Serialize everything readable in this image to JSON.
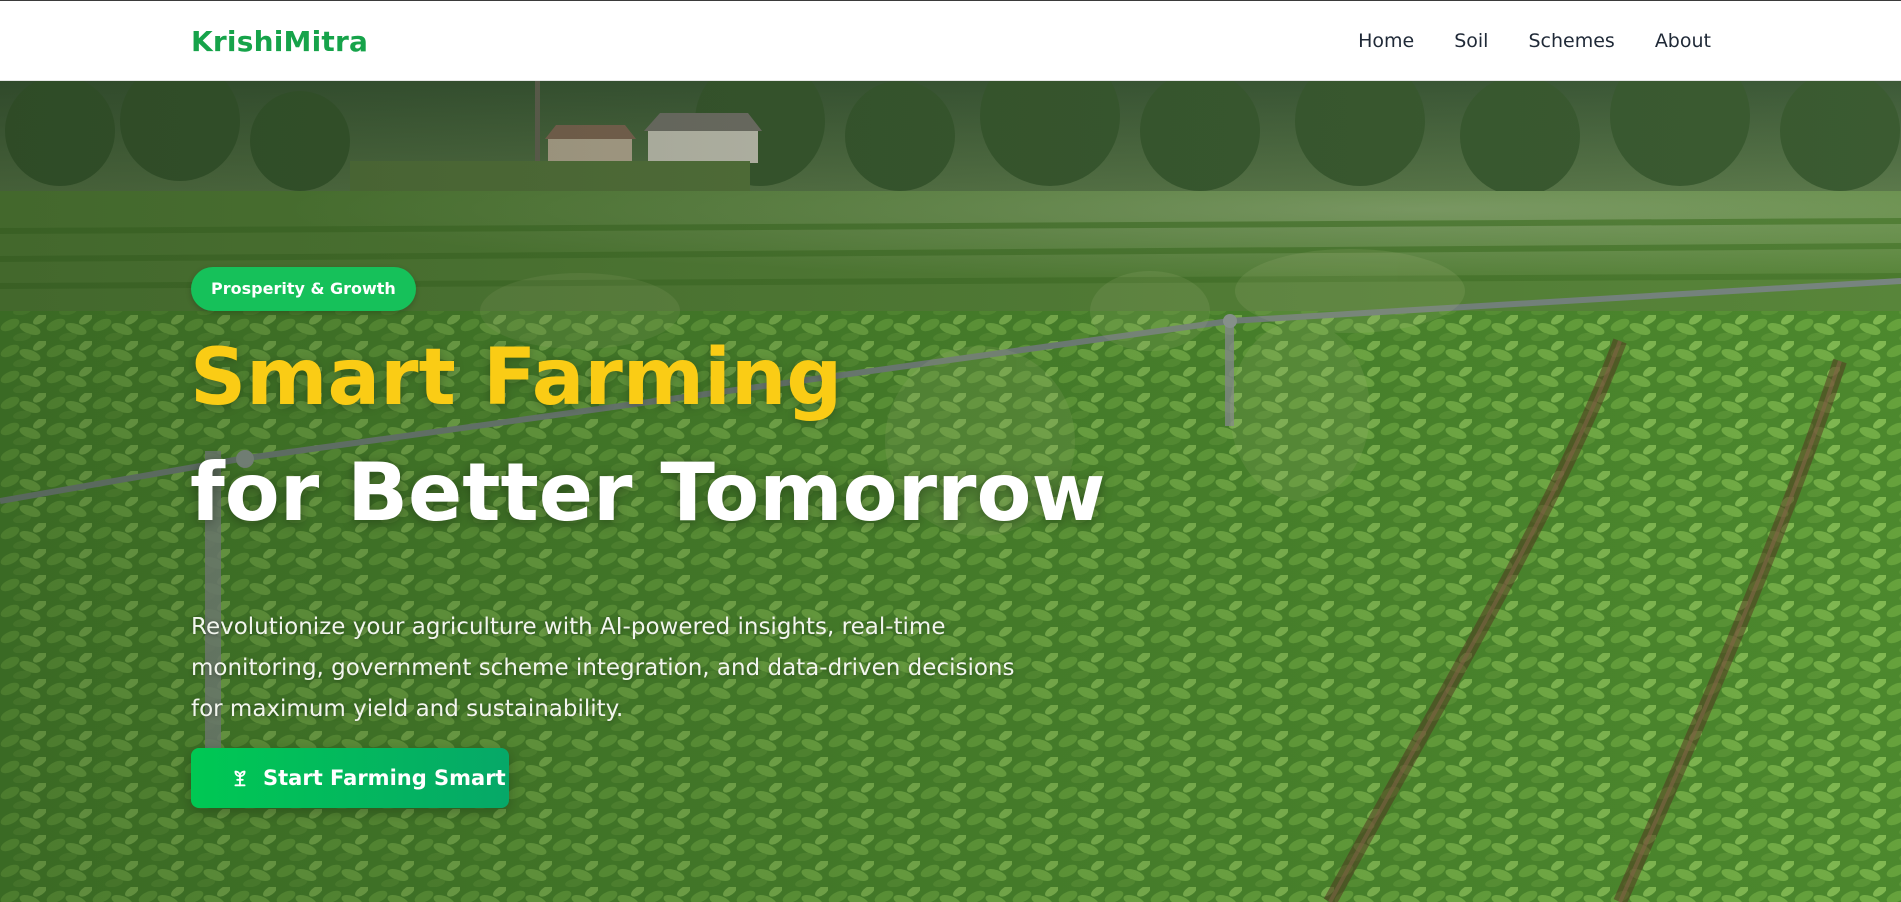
{
  "brand": {
    "name": "KrishiMitra",
    "color": "#16a34a"
  },
  "nav": {
    "items": [
      {
        "label": "Home"
      },
      {
        "label": "Soil"
      },
      {
        "label": "Schemes"
      },
      {
        "label": "About"
      }
    ]
  },
  "hero": {
    "badge": "Prosperity & Growth",
    "title_line1": "Smart Farming",
    "title_line2": "for Better Tomorrow",
    "description": "Revolutionize your agriculture with AI-powered insights, real-time monitoring, government scheme integration, and data-driven decisions for maximum yield and sustainability.",
    "cta_label": "Start Farming Smart",
    "cta_icon": "sprout-icon",
    "background": "farm-field-irrigation-photo",
    "colors": {
      "title_accent": "#facc15",
      "badge": "#16c15a",
      "cta_start": "#00c853",
      "cta_end": "#06a868"
    }
  }
}
